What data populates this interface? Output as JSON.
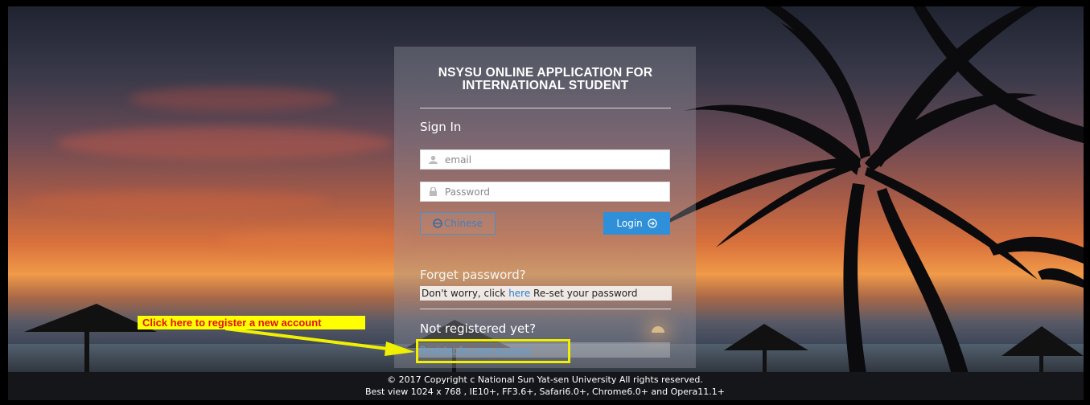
{
  "panel": {
    "title_line1": "NSYSU ONLINE APPLICATION FOR",
    "title_line2": "INTERNATIONAL STUDENT",
    "sign_in_heading": "Sign In",
    "email_placeholder": "email",
    "password_placeholder": "Password",
    "language_button": "Chinese",
    "login_button": "Login",
    "forget_heading": "Forget password?",
    "forget_text_before": "Don't worry, click ",
    "forget_link": "here",
    "forget_text_after": " Re-set your password",
    "not_registered_heading": "Not registered yet?",
    "register_link": "Register for new account"
  },
  "annotation": {
    "callout_text": "Click here to register a new account",
    "callout_bg": "#ffff00",
    "callout_color": "#e01010",
    "highlight_color": "#f0f000"
  },
  "footer": {
    "copyright": "© 2017 Copyright c National Sun Yat-sen University All rights reserved.",
    "best_view": "Best view 1024 x 768 , IE10+, FF3.6+, Safari6.0+, Chrome6.0+ and Opera11.1+"
  },
  "icons": {
    "email": "user-icon",
    "password": "lock-icon",
    "language": "globe-icon",
    "login": "arrow-circle-right-icon"
  },
  "colors": {
    "accent": "#2f8fd8",
    "link": "#2a7fcf"
  }
}
